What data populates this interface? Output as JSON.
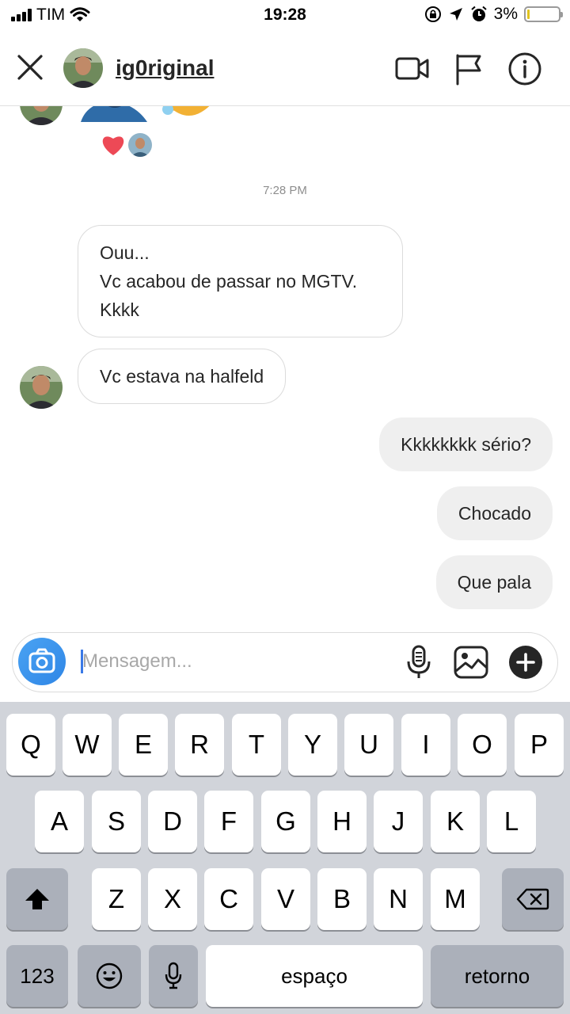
{
  "status_bar": {
    "carrier": "TIM",
    "time": "19:28",
    "battery": "3%",
    "battery_level": 0.03
  },
  "header": {
    "username": "ig0riginal",
    "icons": [
      "close-icon",
      "video-call-icon",
      "flag-icon",
      "info-icon"
    ]
  },
  "chat": {
    "timestamp": "7:28 PM",
    "incoming": [
      {
        "lines": [
          "Ouu...",
          "Vc acabou de passar no MGTV.",
          "Kkkk"
        ]
      },
      {
        "lines": [
          "Vc estava na halfeld"
        ]
      }
    ],
    "outgoing": [
      "Kkkkkkkk sério?",
      "Chocado",
      "Que pala"
    ],
    "reactions": [
      "heart-icon"
    ]
  },
  "composer": {
    "placeholder": "Mensagem...",
    "icons": [
      "camera-icon",
      "microphone-icon",
      "gallery-icon",
      "plus-icon"
    ]
  },
  "keyboard": {
    "row1": [
      "Q",
      "W",
      "E",
      "R",
      "T",
      "Y",
      "U",
      "I",
      "O",
      "P"
    ],
    "row2": [
      "A",
      "S",
      "D",
      "F",
      "G",
      "H",
      "J",
      "K",
      "L"
    ],
    "row3": [
      "Z",
      "X",
      "C",
      "V",
      "B",
      "N",
      "M"
    ],
    "numbers_key": "123",
    "space_key": "espaço",
    "return_key": "retorno"
  },
  "colors": {
    "accent": "#3897f0",
    "outgoing_bubble": "#efefef",
    "keyboard_bg": "#d1d4da",
    "heart": "#ed4956"
  }
}
